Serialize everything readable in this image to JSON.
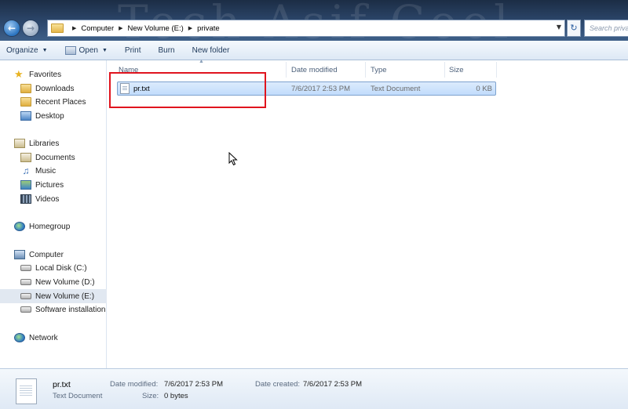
{
  "address_bar": {
    "crumbs": [
      "Computer",
      "New Volume (E:)",
      "private"
    ],
    "search_placeholder": "Search private"
  },
  "watermark": "Tech Asif Cool",
  "toolbar": {
    "organize": "Organize",
    "open": "Open",
    "print": "Print",
    "burn": "Burn",
    "new_folder": "New folder"
  },
  "nav": {
    "favorites": "Favorites",
    "downloads": "Downloads",
    "recent_places": "Recent Places",
    "desktop": "Desktop",
    "libraries": "Libraries",
    "documents": "Documents",
    "music": "Music",
    "pictures": "Pictures",
    "videos": "Videos",
    "homegroup": "Homegroup",
    "computer": "Computer",
    "local_disk": "Local Disk (C:)",
    "new_volume_d": "New Volume (D:)",
    "new_volume_e": "New Volume (E:)",
    "software_installation": "Software installation",
    "network": "Network"
  },
  "columns": {
    "name": "Name",
    "date_modified": "Date modified",
    "type": "Type",
    "size": "Size"
  },
  "files": [
    {
      "name": "pr.txt",
      "date_modified": "7/6/2017 2:53 PM",
      "type": "Text Document",
      "size": "0 KB"
    }
  ],
  "details": {
    "name": "pr.txt",
    "type": "Text Document",
    "date_modified_label": "Date modified:",
    "date_modified": "7/6/2017 2:53 PM",
    "date_created_label": "Date created:",
    "date_created": "7/6/2017 2:53 PM",
    "size_label": "Size:",
    "size": "0 bytes"
  },
  "colors": {
    "highlight_box": "#e0141e",
    "selection": "#c1dcfc"
  }
}
